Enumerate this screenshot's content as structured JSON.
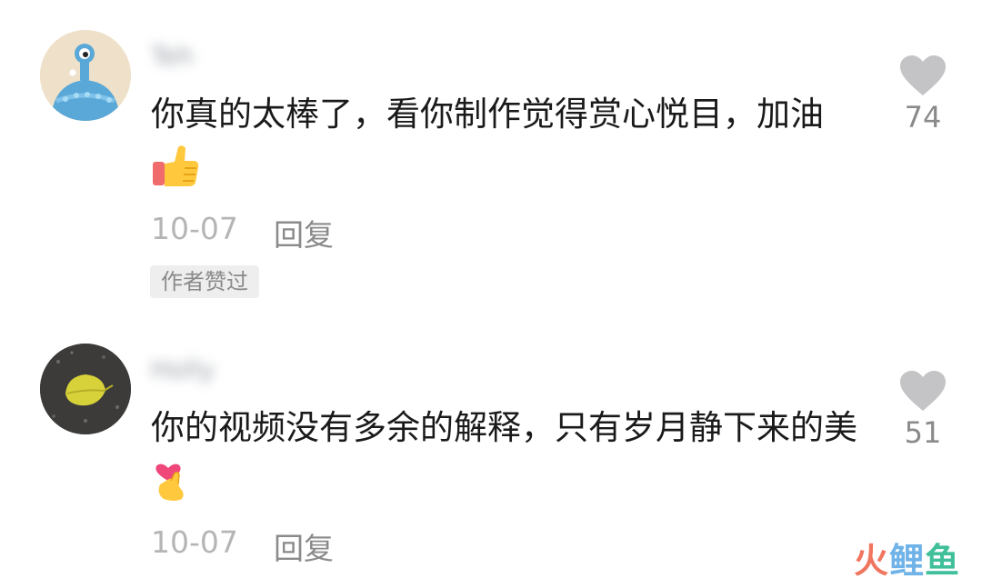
{
  "comments": [
    {
      "username": "Teh",
      "text": "你真的太棒了，看你制作觉得赏心悦目，加油",
      "emoji": "thumbs-up",
      "date": "10-07",
      "reply_label": "回复",
      "author_badge": "作者赞过",
      "like_count": "74"
    },
    {
      "username": "Holly",
      "text": "你的视频没有多余的解释，只有岁月静下来的美",
      "emoji": "finger-heart",
      "date": "10-07",
      "reply_label": "回复",
      "like_count": "51"
    }
  ],
  "watermark": {
    "part1": "火",
    "part2": "鲤",
    "part3": "鱼"
  }
}
